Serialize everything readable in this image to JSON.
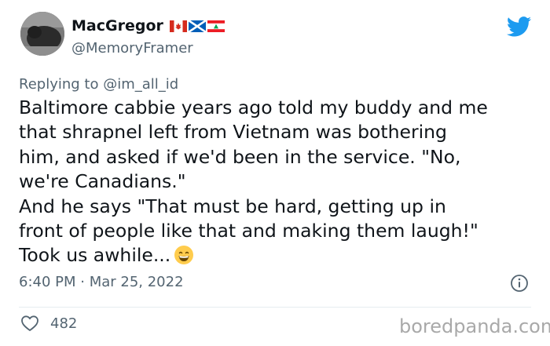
{
  "author": {
    "display_name": "MacGregor",
    "handle": "@MemoryFramer",
    "flags": [
      "flag-canada",
      "flag-scotland",
      "flag-lebanon"
    ]
  },
  "reply": {
    "prefix": "Replying to ",
    "mention": "@im_all_id"
  },
  "tweet": {
    "lines": [
      "Baltimore cabbie years ago told my buddy and me",
      "that shrapnel left from Vietnam was bothering",
      "him, and asked if we'd been in the service. \"No,",
      "we're Canadians.\"",
      "And he says \"That must be hard, getting up in",
      "front of people like that and making them laugh!\"",
      "Took us awhile..."
    ],
    "emoji": "grinning-face-emoji",
    "timestamp": "6:40 PM · Mar 25, 2022"
  },
  "stats": {
    "likes": "482"
  },
  "watermark": "boredpanda.com",
  "colors": {
    "twitter_blue": "#1d9bf0",
    "secondary_text": "#536471",
    "primary_text": "#0f1419"
  }
}
